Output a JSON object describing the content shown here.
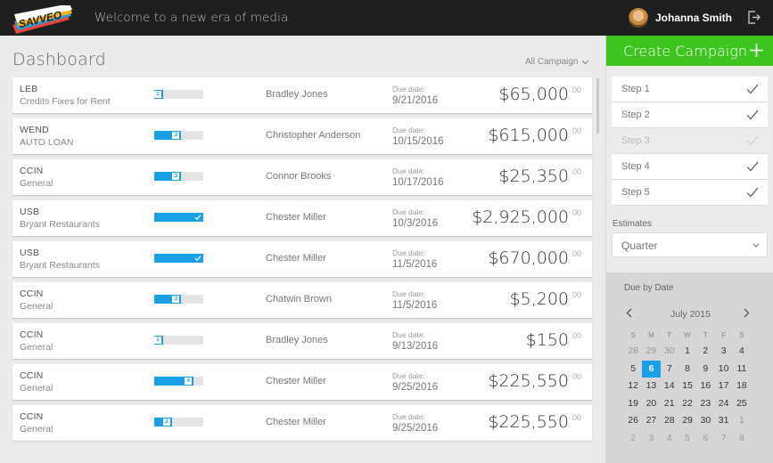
{
  "header": {
    "welcome": "Welcome to a new era of media",
    "user_name": "Johanna Smith",
    "brand_colors": [
      "#ffffff",
      "#f2b21c",
      "#2e9cd6",
      "#e7473c"
    ]
  },
  "dashboard": {
    "title": "Dashboard",
    "filter_label": "All Campaign",
    "due_label": "Due date:",
    "rows": [
      {
        "code": "LEB",
        "sub": "Credits Fixes for Rent",
        "step": "1",
        "progress": 0.18,
        "complete": false,
        "person": "Bradley Jones",
        "due": "9/21/2016",
        "amount": "$65,000",
        "cents": "00"
      },
      {
        "code": "WEND",
        "sub": "AUTO LOAN",
        "step": "3",
        "progress": 0.55,
        "complete": false,
        "person": "Christopher Anderson",
        "due": "10/15/2016",
        "amount": "$615,000",
        "cents": "00"
      },
      {
        "code": "CCIN",
        "sub": "General",
        "step": "3",
        "progress": 0.55,
        "complete": false,
        "person": "Connor Brooks",
        "due": "10/17/2016",
        "amount": "$25,350",
        "cents": "00"
      },
      {
        "code": "USB",
        "sub": "Bryant Restaurants",
        "step": "",
        "progress": 1.0,
        "complete": true,
        "person": "Chester Miller",
        "due": "10/3/2016",
        "amount": "$2,925,000",
        "cents": "00"
      },
      {
        "code": "USB",
        "sub": "Bryant Restaurants",
        "step": "",
        "progress": 1.0,
        "complete": true,
        "person": "Chester Miller",
        "due": "11/5/2016",
        "amount": "$670,000",
        "cents": "00"
      },
      {
        "code": "CCIN",
        "sub": "General",
        "step": "3",
        "progress": 0.55,
        "complete": false,
        "person": "Chatwin Brown",
        "due": "11/5/2016",
        "amount": "$5,200",
        "cents": "00"
      },
      {
        "code": "CCIN",
        "sub": "General",
        "step": "1",
        "progress": 0.18,
        "complete": false,
        "person": "Bradley Jones",
        "due": "9/13/2016",
        "amount": "$150",
        "cents": "00"
      },
      {
        "code": "CCIN",
        "sub": "General",
        "step": "4",
        "progress": 0.8,
        "complete": false,
        "person": "Chester Miller",
        "due": "9/25/2016",
        "amount": "$225,550",
        "cents": "00"
      },
      {
        "code": "CCIN",
        "sub": "General",
        "step": "2",
        "progress": 0.36,
        "complete": false,
        "person": "Chester Miller",
        "due": "9/25/2016",
        "amount": "$225,550",
        "cents": "00"
      }
    ]
  },
  "panel": {
    "create_label": "Create Campaign",
    "accent": "#3ec41e",
    "steps": [
      {
        "label": "Step 1",
        "done": true
      },
      {
        "label": "Step 2",
        "done": true
      },
      {
        "label": "Step 3",
        "done": false
      },
      {
        "label": "Step 4",
        "done": true
      },
      {
        "label": "Step 5",
        "done": true
      }
    ],
    "estimates_label": "Estimates",
    "estimates_value": "Quarter",
    "calendar": {
      "title": "Due by Date",
      "month": "July 2015",
      "weekdays": [
        "S",
        "M",
        "T",
        "W",
        "T",
        "F",
        "S"
      ],
      "weeks": [
        [
          "28",
          "29",
          "30",
          "1",
          "2",
          "3",
          "4"
        ],
        [
          "5",
          "6",
          "7",
          "8",
          "9",
          "10",
          "11"
        ],
        [
          "12",
          "13",
          "14",
          "15",
          "16",
          "17",
          "18"
        ],
        [
          "19",
          "20",
          "21",
          "22",
          "23",
          "24",
          "25"
        ],
        [
          "26",
          "27",
          "28",
          "29",
          "30",
          "31",
          "1"
        ],
        [
          "2",
          "3",
          "4",
          "5",
          "6",
          "7",
          "8"
        ]
      ],
      "selected": "6"
    }
  }
}
